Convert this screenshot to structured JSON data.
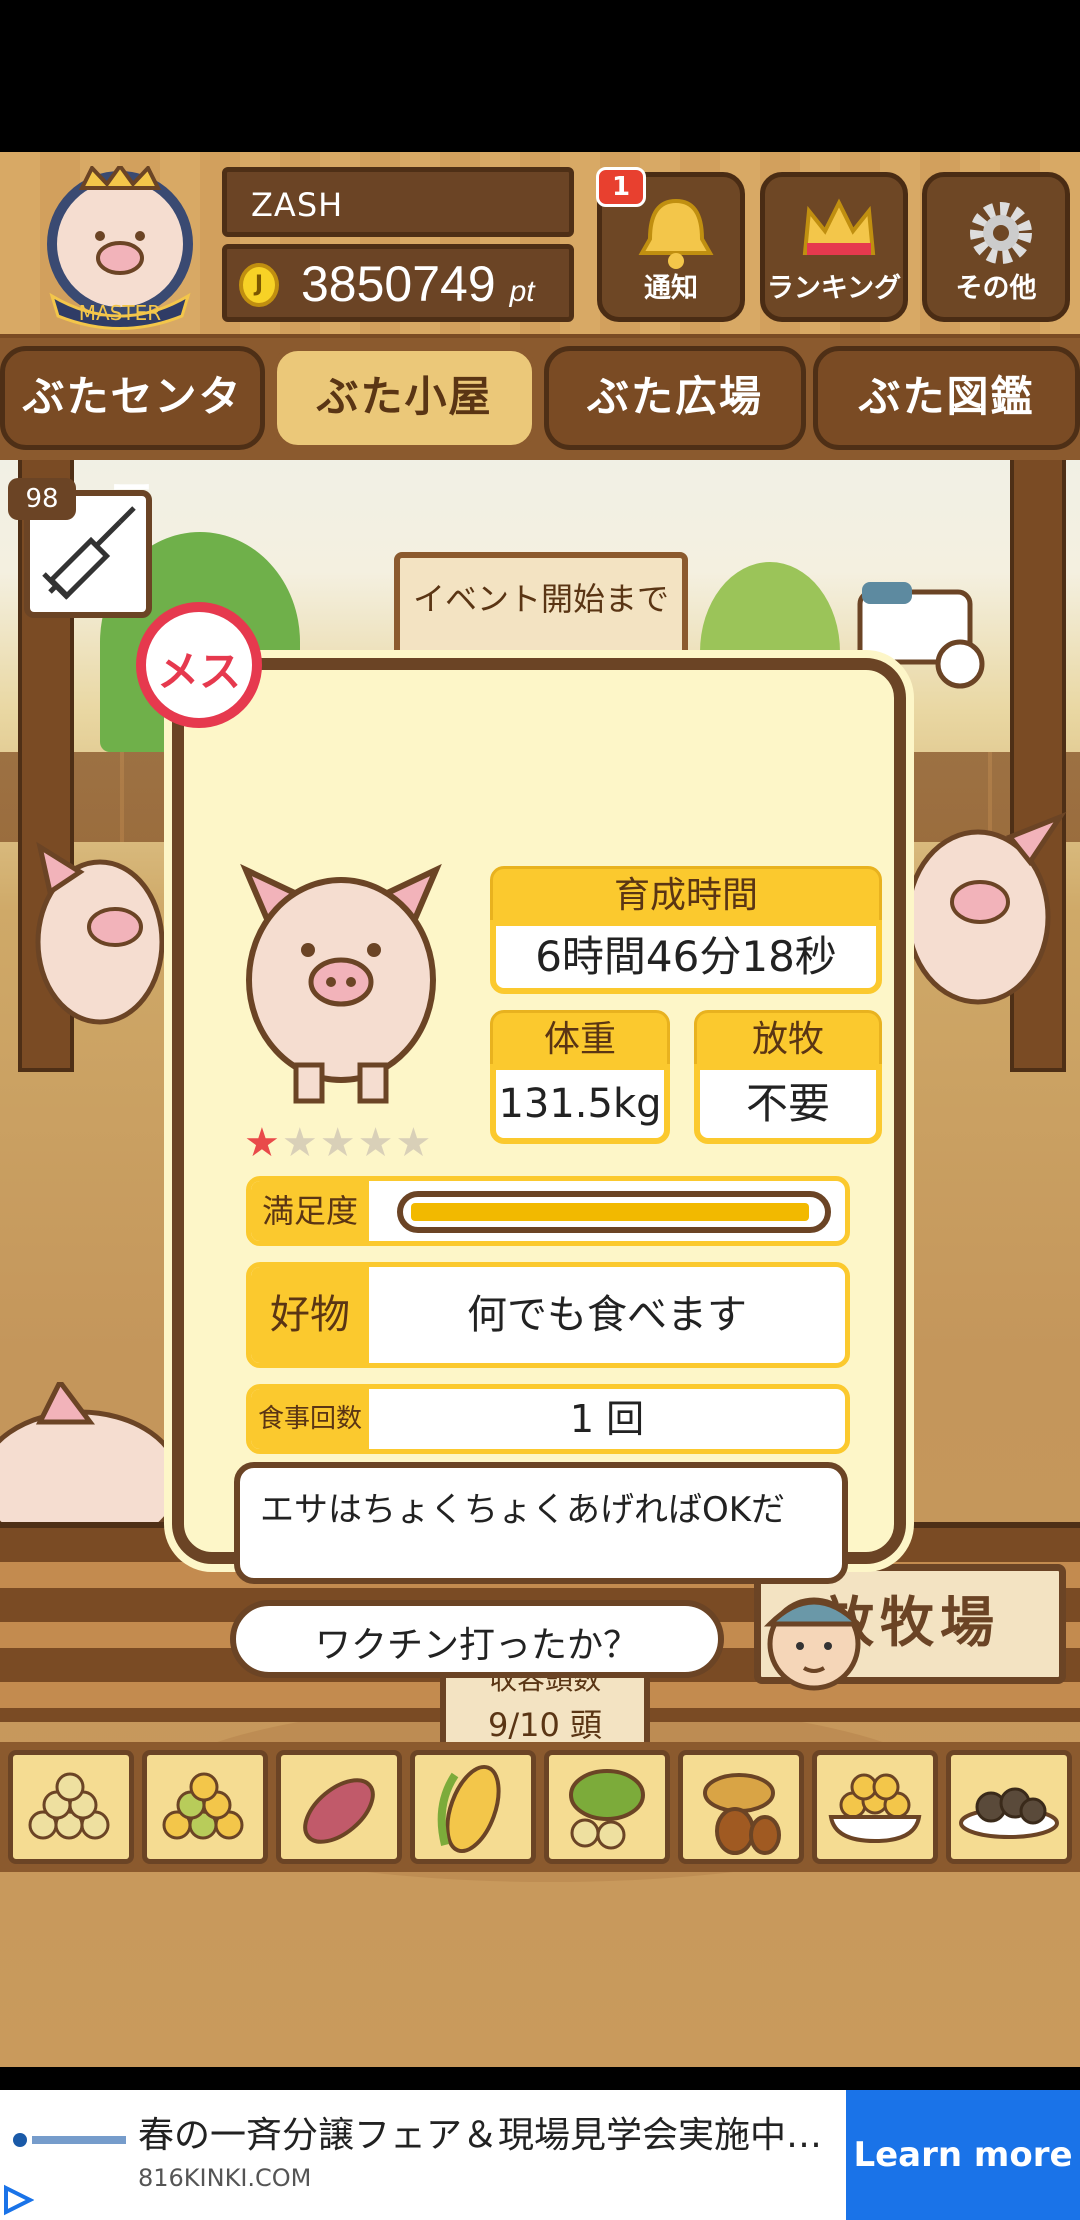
{
  "player": {
    "name": "ZASH",
    "points": "3850749",
    "points_unit": "pt",
    "rank_badge": "MASTER"
  },
  "header_buttons": {
    "notify_label": "通知",
    "notify_count": "1",
    "ranking_label": "ランキング",
    "other_label": "その他"
  },
  "tabs": [
    "ぶたセンター",
    "ぶた小屋",
    "ぶた広場",
    "ぶた図鑑"
  ],
  "active_tab": 1,
  "scene": {
    "event_sign": "イベント開始まで",
    "syringe_count": "98",
    "corral_sign": "放牧場",
    "capacity_label": "収容頭数",
    "capacity_value": "9/10 頭"
  },
  "pig": {
    "gender": "メス",
    "stars_filled": "★",
    "stars_empty": "★★★★",
    "growth_time_label": "育成時間",
    "growth_time": "6時間46分18秒",
    "weight_label": "体重",
    "weight": "131.5kg",
    "grazing_label": "放牧",
    "grazing": "不要",
    "satisfaction_label": "満足度",
    "satisfaction": 0.98,
    "favorite_label": "好物",
    "favorite": "何でも食べます",
    "meals_label": "食事回数",
    "meals": "1 回",
    "farmer_tip": "エサはちょくちょくあげればOKだ",
    "farmer_question": "ワクチン打ったか？"
  },
  "foods": [
    "food-grain-icon",
    "food-mixed-grain-icon",
    "food-sweet-potato-icon",
    "food-corn-icon",
    "food-vegetable-icon",
    "food-acorn-icon",
    "food-bowl-icon",
    "food-dish-icon"
  ],
  "ad": {
    "title": "春の一斉分譲フェア＆現場見学会実施中…",
    "domain": "816KINKI.COM",
    "cta": "Learn more"
  },
  "colors": {
    "wood": "#6b4425",
    "card_bg": "#fdf6c8",
    "accent_yellow": "#fbc92e",
    "female_red": "#e6394e",
    "ad_blue": "#1a73e8"
  }
}
